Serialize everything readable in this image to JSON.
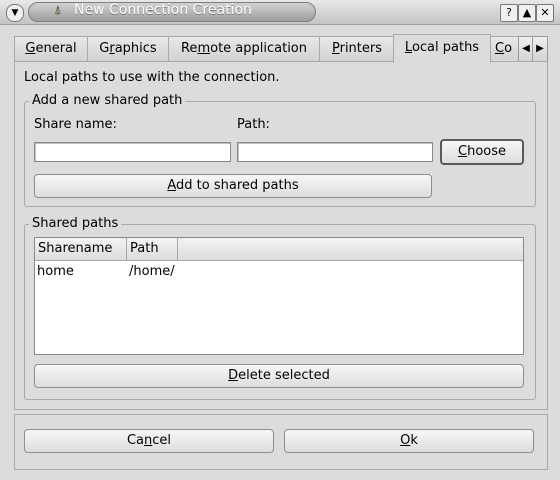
{
  "window": {
    "title": "New Connection Creation"
  },
  "tabs": [
    {
      "label": "General",
      "accel": "G",
      "rest": "eneral"
    },
    {
      "label": "Graphics",
      "accel": "G",
      "rest": "raphics",
      "pre": ""
    },
    {
      "label": "Remote application",
      "pre": "Re",
      "accel": "m",
      "rest": "ote application"
    },
    {
      "label": "Printers",
      "accel": "P",
      "rest": "rinters"
    },
    {
      "label": "Local paths",
      "accel": "L",
      "rest": "ocal paths"
    },
    {
      "label": "Co",
      "accel": "C",
      "rest": "o"
    }
  ],
  "intro": "Local paths to use with the connection.",
  "add_group": {
    "title": "Add a new shared path",
    "share_name_label": "Share name:",
    "path_label": "Path:",
    "share_name_value": "",
    "path_value": "",
    "choose": {
      "label": "Choose",
      "accel": "C",
      "rest": "hoose"
    },
    "add": {
      "label": "Add to shared paths",
      "accel": "A",
      "rest": "dd to shared paths"
    }
  },
  "shared_group": {
    "title": "Shared paths",
    "columns": [
      "Sharename",
      "Path"
    ],
    "rows": [
      {
        "sharename": "home",
        "path": "/home/"
      }
    ],
    "delete": {
      "label": "Delete selected",
      "accel": "D",
      "rest": "elete selected"
    }
  },
  "footer": {
    "cancel": {
      "label": "Cancel",
      "pre": "Ca",
      "accel": "n",
      "rest": "cel"
    },
    "ok": {
      "label": "Ok",
      "accel": "O",
      "rest": "k"
    }
  }
}
